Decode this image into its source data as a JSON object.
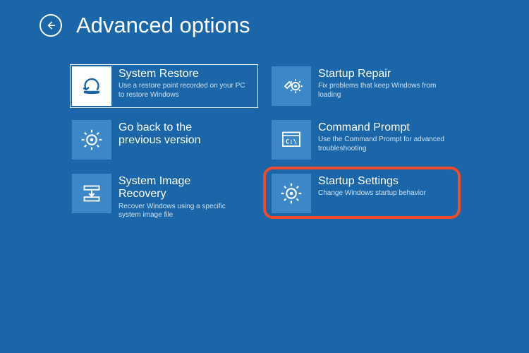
{
  "header": {
    "title": "Advanced options"
  },
  "tiles": {
    "system_restore": {
      "title": "System Restore",
      "desc": "Use a restore point recorded on your PC to restore Windows"
    },
    "startup_repair": {
      "title": "Startup Repair",
      "desc": "Fix problems that keep Windows from loading"
    },
    "go_back": {
      "title": "Go back to the previous version",
      "desc": ""
    },
    "command_prompt": {
      "title": "Command Prompt",
      "desc": "Use the Command Prompt for advanced troubleshooting"
    },
    "system_image": {
      "title": "System Image Recovery",
      "desc": "Recover Windows using a specific system image file"
    },
    "startup_settings": {
      "title": "Startup Settings",
      "desc": "Change Windows startup behavior"
    }
  },
  "colors": {
    "background": "#1a66a8",
    "tile_icon_bg": "#3b87c8",
    "highlight": "#f24a2a"
  }
}
